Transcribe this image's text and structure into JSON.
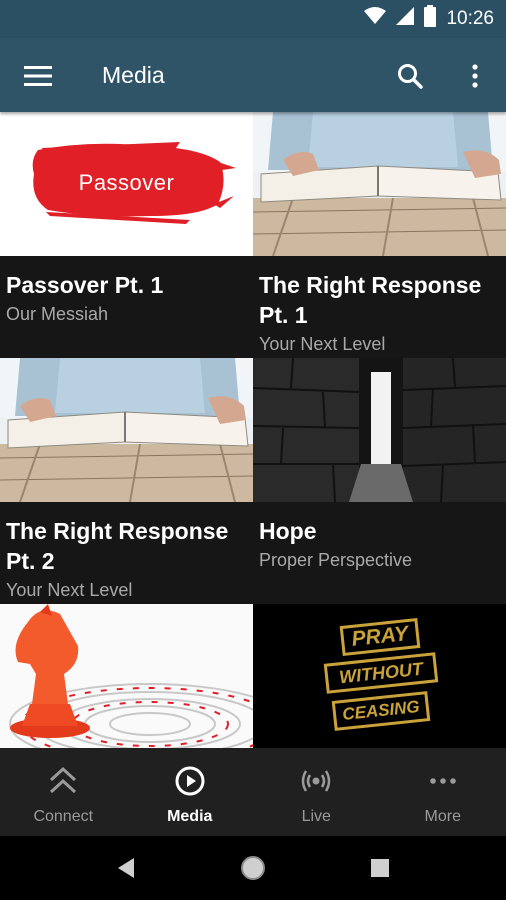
{
  "status_bar": {
    "time": "10:26"
  },
  "app_bar": {
    "title": "Media",
    "icons": [
      "menu-icon",
      "search-icon",
      "more-vert-icon"
    ]
  },
  "media_items": [
    {
      "title": "Passover Pt. 1",
      "subtitle": "Our Messiah",
      "thumbnail_text": "Passover"
    },
    {
      "title": "The Right Response Pt. 1",
      "subtitle": "Your Next Level"
    },
    {
      "title": "The Right Response Pt. 2",
      "subtitle": "Your Next Level"
    },
    {
      "title": "Hope",
      "subtitle": "Proper Perspective"
    },
    {
      "title": "",
      "subtitle": ""
    },
    {
      "title": "",
      "subtitle": "",
      "thumbnail_text": [
        "PRAY",
        "WITHOUT",
        "CEASING"
      ]
    }
  ],
  "bottom_nav": {
    "items": [
      {
        "label": "Connect",
        "icon": "double-chevron-up-icon",
        "active": false
      },
      {
        "label": "Media",
        "icon": "play-circle-icon",
        "active": true
      },
      {
        "label": "Live",
        "icon": "broadcast-icon",
        "active": false
      },
      {
        "label": "More",
        "icon": "more-horiz-icon",
        "active": false
      }
    ]
  },
  "colors": {
    "status_bar": "#2b4f63",
    "app_bar": "#2f5467",
    "background": "#161616",
    "bottom_nav": "#202020",
    "passover_red": "#e01f26",
    "pray_gold": "#c9a23a"
  }
}
